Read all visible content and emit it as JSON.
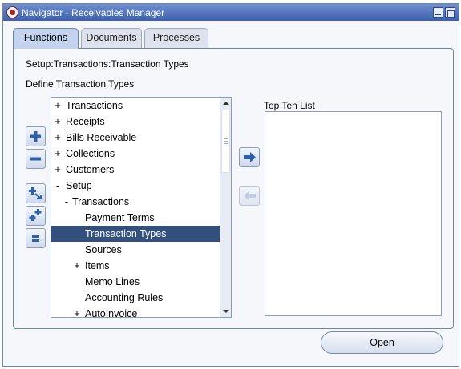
{
  "window": {
    "title": "Navigator - Receivables Manager",
    "minimize_icon": "minimize-icon",
    "maximize_icon": "maximize-icon"
  },
  "tabs": [
    {
      "label": "Functions",
      "active": true
    },
    {
      "label": "Documents",
      "active": false
    },
    {
      "label": "Processes",
      "active": false
    }
  ],
  "breadcrumb": "Setup:Transactions:Transaction Types",
  "define_label": "Define Transaction Types",
  "tree": {
    "items": [
      {
        "label": "Transactions",
        "expander": "+",
        "level": 0,
        "selected": false
      },
      {
        "label": "Receipts",
        "expander": "+",
        "level": 0,
        "selected": false
      },
      {
        "label": "Bills Receivable",
        "expander": "+",
        "level": 0,
        "selected": false
      },
      {
        "label": "Collections",
        "expander": "+",
        "level": 0,
        "selected": false
      },
      {
        "label": "Customers",
        "expander": "+",
        "level": 0,
        "selected": false
      },
      {
        "label": "Setup",
        "expander": "-",
        "level": 0,
        "selected": false
      },
      {
        "label": "Transactions",
        "expander": "-",
        "level": 1,
        "selected": false
      },
      {
        "label": "Payment Terms",
        "expander": "",
        "level": 2,
        "selected": false
      },
      {
        "label": "Transaction Types",
        "expander": "",
        "level": 2,
        "selected": true
      },
      {
        "label": "Sources",
        "expander": "",
        "level": 2,
        "selected": false
      },
      {
        "label": "Items",
        "expander": "+",
        "level": 2,
        "selected": false
      },
      {
        "label": "Memo Lines",
        "expander": "",
        "level": 2,
        "selected": false
      },
      {
        "label": "Accounting Rules",
        "expander": "",
        "level": 2,
        "selected": false
      },
      {
        "label": "AutoInvoice",
        "expander": "+",
        "level": 2,
        "selected": false
      }
    ]
  },
  "side_buttons": [
    "expand-icon",
    "collapse-icon",
    "expand-branch-icon",
    "expand-all-icon",
    "collapse-all-icon"
  ],
  "top_ten": {
    "label": "Top Ten List",
    "items": []
  },
  "open_button": {
    "mnemonic": "O",
    "rest": "pen"
  },
  "colors": {
    "titlebar": "#3d5fae",
    "selection": "#33507d",
    "active_tab": "#c4d3ee"
  }
}
